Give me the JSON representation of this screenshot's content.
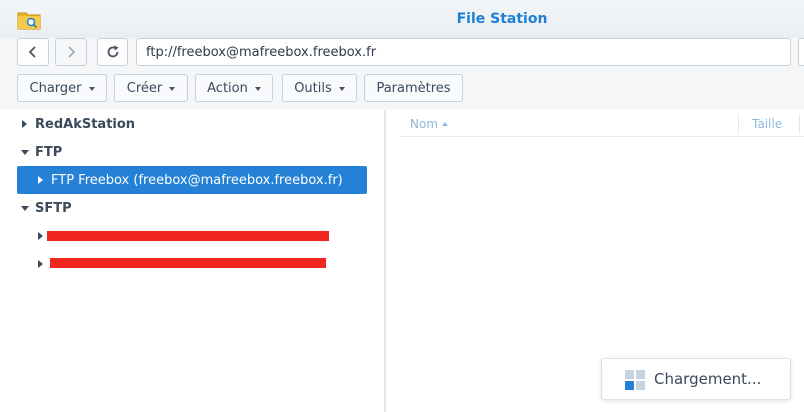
{
  "window": {
    "title": "File Station",
    "icon": "folder-search-icon"
  },
  "toolbar": {
    "back_icon": "chevron-left-icon",
    "forward_icon": "chevron-right-icon",
    "refresh_icon": "refresh-icon",
    "path_value": "ftp://freebox@mafreebox.freebox.fr",
    "buttons": {
      "charger": "Charger",
      "creer": "Créer",
      "action": "Action",
      "outils": "Outils",
      "parametres": "Paramètres"
    }
  },
  "tree": {
    "groups": [
      {
        "label": "RedAkStation",
        "expanded": false
      },
      {
        "label": "FTP",
        "expanded": true,
        "children": [
          "FTP Freebox (freebox@mafreebox.freebox.fr)"
        ]
      },
      {
        "label": "SFTP",
        "expanded": true,
        "children_redacted": 2
      }
    ],
    "selected_item": "FTP Freebox (freebox@mafreebox.freebox.fr)"
  },
  "file_list": {
    "columns": [
      "Nom",
      "Taille"
    ],
    "sort_column": "Nom",
    "sort_direction": "ascending"
  },
  "status": {
    "loading_text": "Chargement..."
  },
  "colors": {
    "accent": "#1d80d4",
    "selection": "#2481d6",
    "redaction": "#f0261f",
    "header_text": "#8fb8de"
  }
}
